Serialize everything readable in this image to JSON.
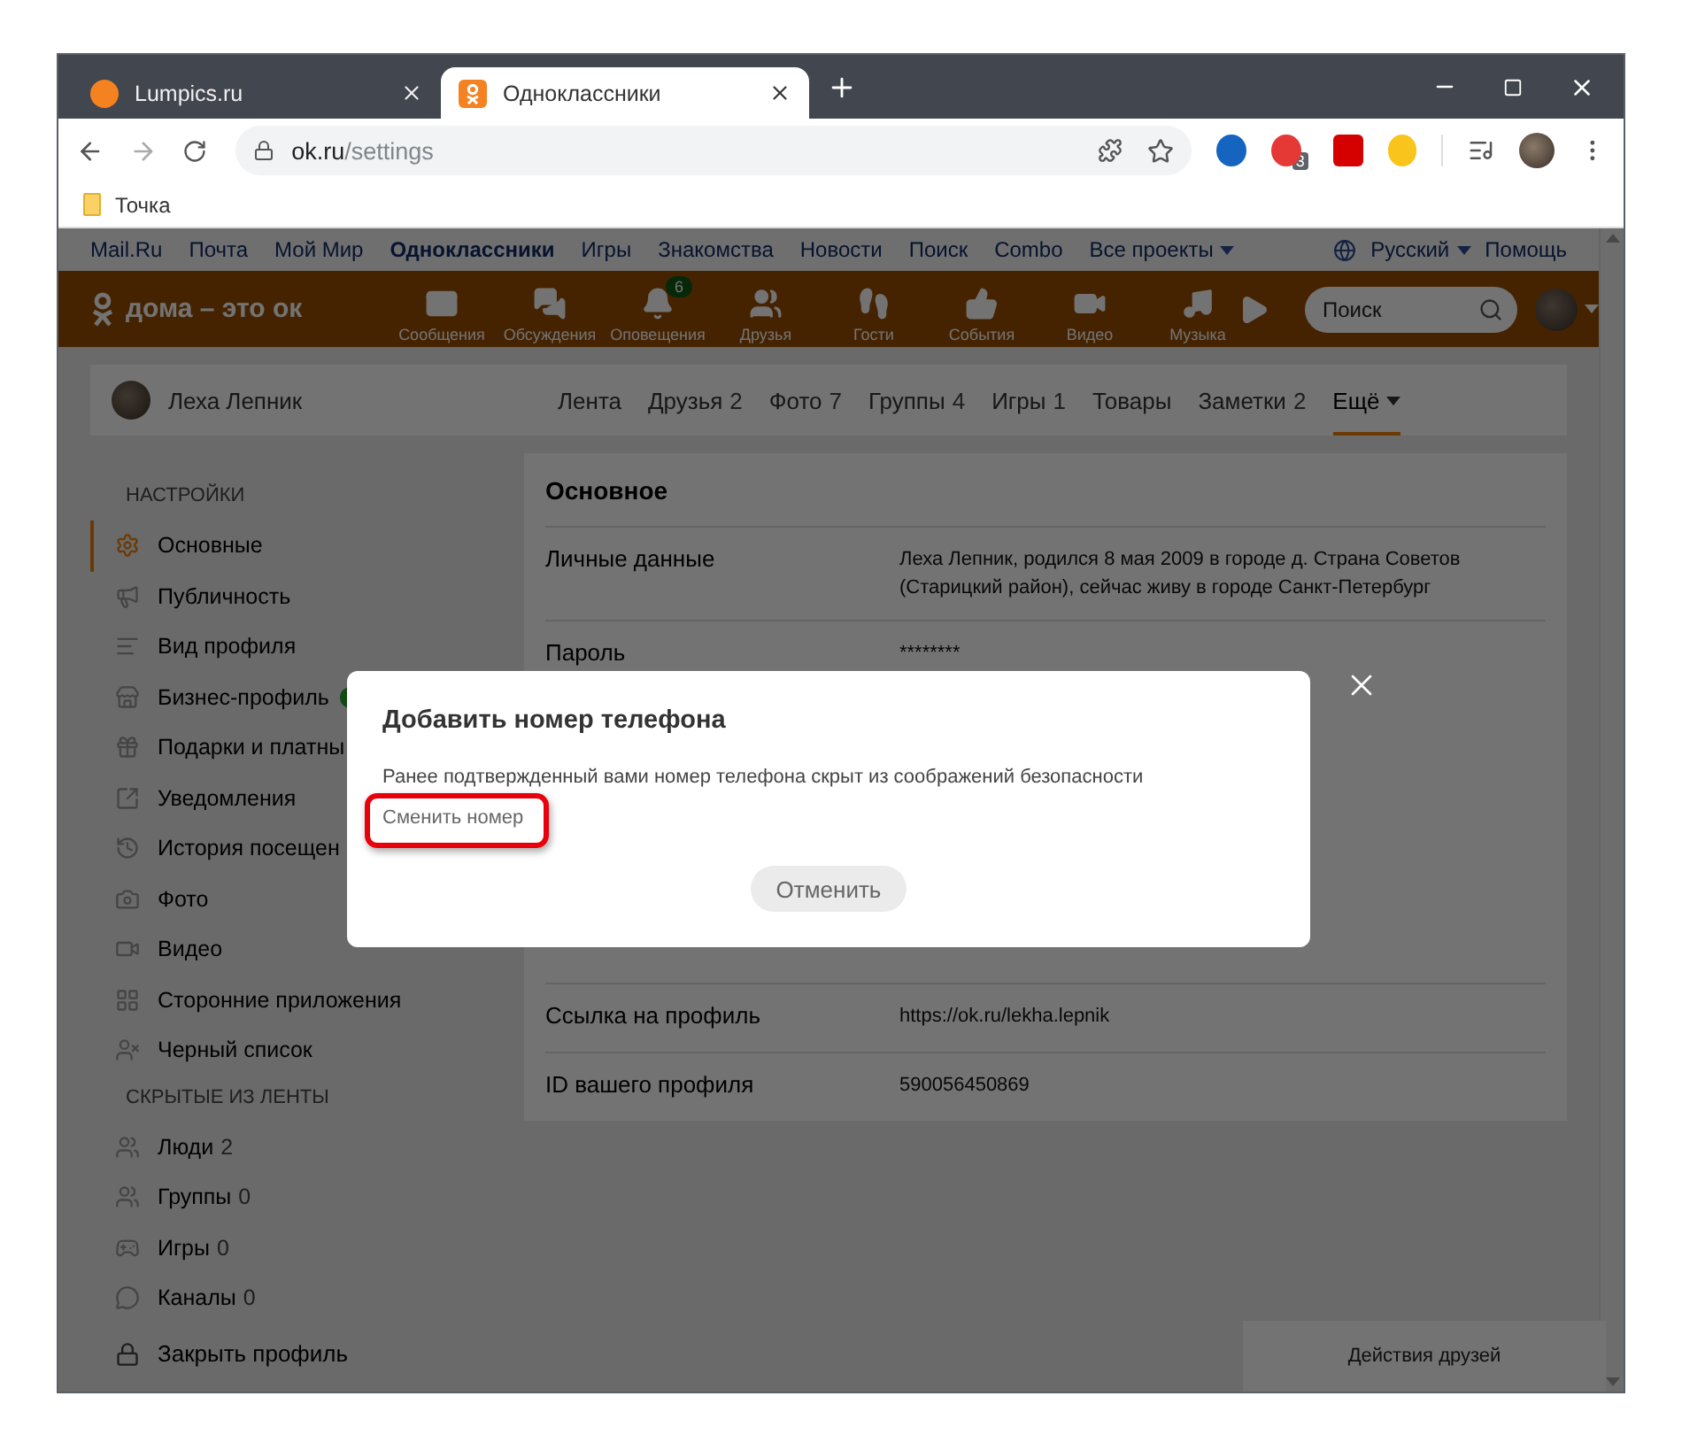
{
  "browser": {
    "tabs": [
      {
        "title": "Lumpics.ru",
        "selected": false,
        "kind": "lumpics"
      },
      {
        "title": "Одноклассники",
        "selected": true,
        "kind": "ok"
      }
    ],
    "address": {
      "host": "ok.ru",
      "path": "/settings"
    },
    "extension_badge": "3",
    "bookmarks": [
      {
        "label": "Точка"
      }
    ]
  },
  "portal_bar": {
    "links": [
      {
        "label": "Mail.Ru",
        "selected": false
      },
      {
        "label": "Почта",
        "selected": false
      },
      {
        "label": "Мой Мир",
        "selected": false
      },
      {
        "label": "Одноклассники",
        "selected": true
      },
      {
        "label": "Игры",
        "selected": false
      },
      {
        "label": "Знакомства",
        "selected": false
      },
      {
        "label": "Новости",
        "selected": false
      },
      {
        "label": "Поиск",
        "selected": false
      },
      {
        "label": "Combo",
        "selected": false
      }
    ],
    "projects": "Все проекты",
    "language": "Русский",
    "help": "Помощь"
  },
  "header": {
    "logo": "дома – это ок",
    "nav": [
      {
        "label": "Сообщения"
      },
      {
        "label": "Обсуждения"
      },
      {
        "label": "Оповещения",
        "badge": "6"
      },
      {
        "label": "Друзья"
      },
      {
        "label": "Гости"
      },
      {
        "label": "События"
      },
      {
        "label": "Видео"
      },
      {
        "label": "Музыка"
      }
    ],
    "search": {
      "placeholder": "Поиск"
    }
  },
  "profile": {
    "name": "Леха Лепник",
    "tabs": [
      {
        "label": "Лента",
        "selected": false
      },
      {
        "label": "Друзья",
        "count": "2",
        "selected": false
      },
      {
        "label": "Фото",
        "count": "7",
        "selected": false
      },
      {
        "label": "Группы",
        "count": "4",
        "selected": false
      },
      {
        "label": "Игры",
        "count": "1",
        "selected": false
      },
      {
        "label": "Товары",
        "selected": false
      },
      {
        "label": "Заметки",
        "count": "2",
        "selected": false
      },
      {
        "label": "Ещё",
        "selected": true
      }
    ]
  },
  "sidebar": {
    "sections": [
      {
        "title": "НАСТРОЙКИ",
        "items": [
          {
            "label": "Основные",
            "selected": true,
            "flag": false
          },
          {
            "label": "Публичность",
            "selected": false,
            "flag": false
          },
          {
            "label": "Вид профиля",
            "selected": false,
            "flag": false
          },
          {
            "label": "Бизнес-профиль",
            "selected": false,
            "flag": true
          },
          {
            "label": "Подарки и платны",
            "selected": false,
            "flag": false
          },
          {
            "label": "Уведомления",
            "selected": false,
            "flag": false
          },
          {
            "label": "История посещен",
            "selected": false,
            "flag": false
          },
          {
            "label": "Фото",
            "selected": false,
            "flag": false
          },
          {
            "label": "Видео",
            "selected": false,
            "flag": false
          },
          {
            "label": "Сторонние приложения",
            "selected": false,
            "flag": false
          },
          {
            "label": "Черный список",
            "selected": false,
            "flag": false
          }
        ]
      },
      {
        "title": "СКРЫТЫЕ ИЗ ЛЕНТЫ",
        "items": [
          {
            "label": "Люди",
            "count": "2",
            "selected": false,
            "flag": false
          },
          {
            "label": "Группы",
            "count": "0",
            "selected": false,
            "flag": false
          },
          {
            "label": "Игры",
            "count": "0",
            "selected": false,
            "flag": false
          },
          {
            "label": "Каналы",
            "count": "0",
            "selected": false,
            "flag": false
          }
        ]
      }
    ],
    "close_profile": "Закрыть профиль"
  },
  "settings": {
    "title": "Основное",
    "rows": [
      {
        "label": "Личные данные",
        "value": "Леха Лепник, родился 8 мая 2009 в городе д. Страна Советов (Старицкий район), сейчас живу в городе Санкт-Петербург"
      },
      {
        "label": "Пароль",
        "value": "********"
      },
      {
        "label": "Ссылка на профиль",
        "value": "https://ok.ru/lekha.lepnik"
      },
      {
        "label": "ID вашего профиля",
        "value": "590056450869"
      }
    ]
  },
  "friends_activity": "Действия друзей",
  "dialog": {
    "title": "Добавить номер телефона",
    "text": "Ранее подтвержденный вами номер телефона скрыт из соображений безопасности",
    "link": "Сменить номер",
    "cancel": "Отменить",
    "highlight": true
  }
}
